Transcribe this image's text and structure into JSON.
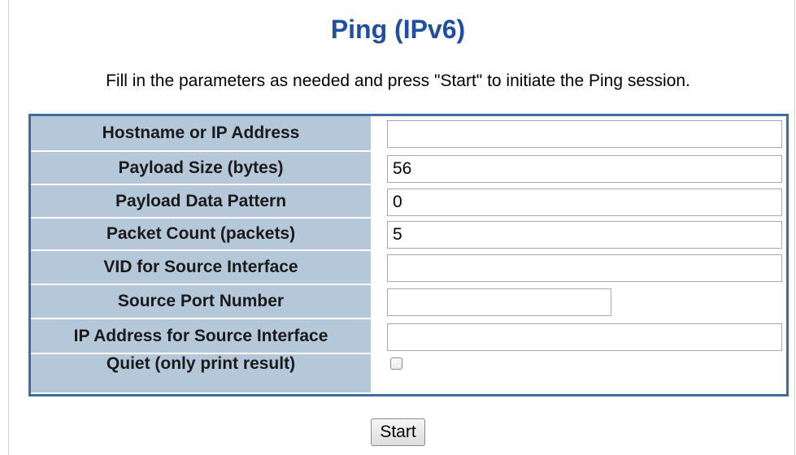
{
  "page": {
    "title": "Ping (IPv6)",
    "instructions": "Fill in the parameters as needed and press \"Start\" to initiate the Ping session."
  },
  "form": {
    "hostname": {
      "label": "Hostname or IP Address",
      "value": ""
    },
    "payload_size": {
      "label": "Payload Size (bytes)",
      "value": "56"
    },
    "payload_pattern": {
      "label": "Payload Data Pattern",
      "value": "0"
    },
    "packet_count": {
      "label": "Packet Count (packets)",
      "value": "5"
    },
    "vid_source": {
      "label": "VID for Source Interface",
      "value": ""
    },
    "source_port": {
      "label": "Source Port Number",
      "value": ""
    },
    "ip_source": {
      "label": "IP Address for Source Interface",
      "value": ""
    },
    "quiet": {
      "label": "Quiet (only print result)",
      "checked": false
    }
  },
  "actions": {
    "start_label": "Start"
  },
  "colors": {
    "title": "#1f4ea6",
    "label_bg": "#b5c8d9",
    "table_border": "#3d6e9e"
  }
}
